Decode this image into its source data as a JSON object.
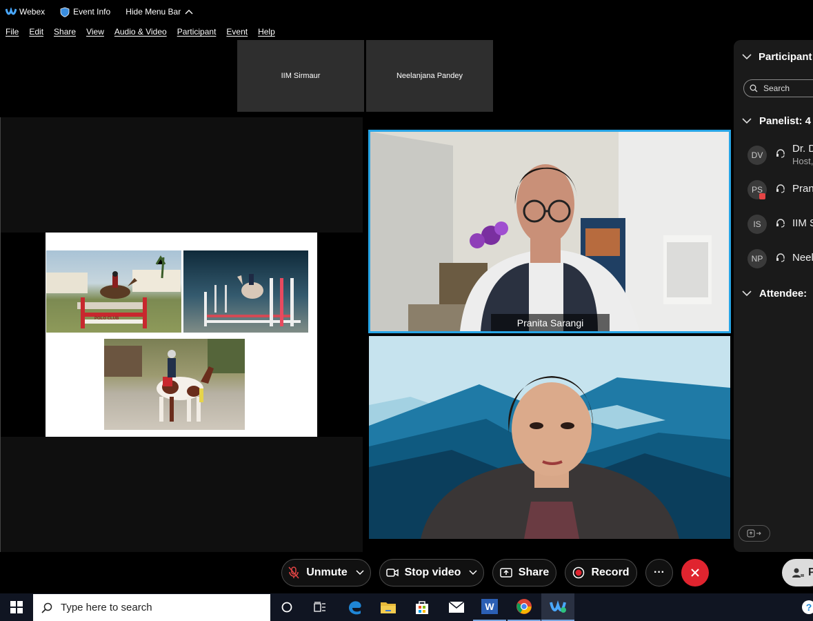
{
  "titlebar": {
    "app_name": "Webex",
    "event_info": "Event Info",
    "hide_menu": "Hide Menu Bar"
  },
  "menu": [
    "File",
    "Edit",
    "Share",
    "View",
    "Audio & Video",
    "Participant",
    "Event",
    "Help"
  ],
  "thumbnails": [
    "IIM Sirmaur",
    "Neelanjana Pandey"
  ],
  "active_speaker": {
    "name": "Pranita Sarangi"
  },
  "slide": {
    "photo_sign": "POLO CLUB"
  },
  "participants_panel": {
    "title": "Participant",
    "search_placeholder": "Search",
    "panelist_header": "Panelist: 4",
    "attendee_header": "Attendee:",
    "panelists": [
      {
        "initials": "DV",
        "name": "Dr. D",
        "role": "Host,"
      },
      {
        "initials": "PS",
        "name": "Pran",
        "role": ""
      },
      {
        "initials": "IS",
        "name": "IIM S",
        "role": ""
      },
      {
        "initials": "NP",
        "name": "Neel",
        "role": ""
      }
    ]
  },
  "toolbar": {
    "unmute": "Unmute",
    "stop_video": "Stop video",
    "share": "Share",
    "record": "Record",
    "more": "···",
    "participants_initial": "P"
  },
  "taskbar": {
    "search_placeholder": "Type here to search",
    "word_letter": "W",
    "help_char": "?"
  },
  "colors": {
    "accent_border": "#27a5e6",
    "leave_red": "#e0242f",
    "unmute_icon_red": "#e54545"
  }
}
